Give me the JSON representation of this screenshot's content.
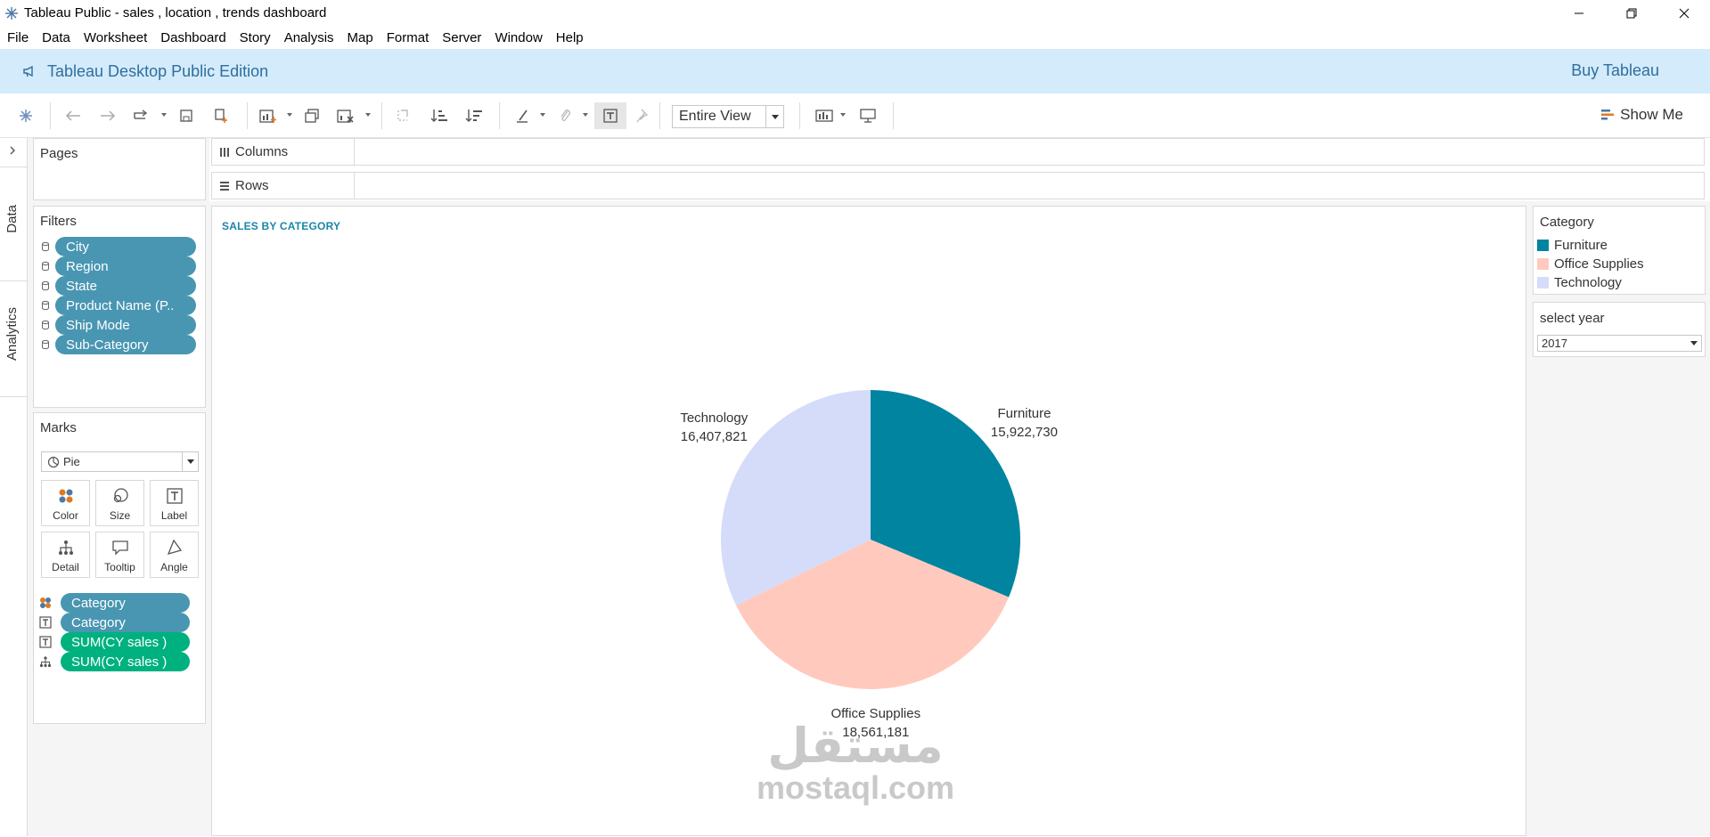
{
  "window": {
    "title": "Tableau Public - sales , location , trends dashboard",
    "buttons": [
      "minimize",
      "restore",
      "close"
    ]
  },
  "menu": [
    "File",
    "Data",
    "Worksheet",
    "Dashboard",
    "Story",
    "Analysis",
    "Map",
    "Format",
    "Server",
    "Window",
    "Help"
  ],
  "banner": {
    "edition": "Tableau Desktop Public Edition",
    "buy": "Buy Tableau"
  },
  "toolbar": {
    "fit": "Entire View",
    "show_me": "Show Me"
  },
  "side_tabs": {
    "data": "Data",
    "analytics": "Analytics"
  },
  "pages": {
    "title": "Pages"
  },
  "filters": {
    "title": "Filters",
    "items": [
      "City",
      "Region",
      "State",
      "Product Name (P..",
      "Ship Mode",
      "Sub-Category"
    ]
  },
  "marks": {
    "title": "Marks",
    "type": "Pie",
    "buttons": [
      "Color",
      "Size",
      "Label",
      "Detail",
      "Tooltip",
      "Angle"
    ],
    "fields": [
      {
        "label": "Category",
        "kind": "color"
      },
      {
        "label": "Category",
        "kind": "label"
      },
      {
        "label": "SUM(CY sales )",
        "kind": "label"
      },
      {
        "label": "SUM(CY sales )",
        "kind": "detail"
      }
    ]
  },
  "shelves": {
    "columns": "Columns",
    "rows": "Rows"
  },
  "view": {
    "title": "SALES BY CATEGORY"
  },
  "chart_data": {
    "type": "pie",
    "title": "SALES BY CATEGORY",
    "categories": [
      "Furniture",
      "Office Supplies",
      "Technology"
    ],
    "values": [
      15922730,
      18561181,
      16407821
    ],
    "value_labels": [
      "15,922,730",
      "18,561,181",
      "16,407,821"
    ],
    "colors": [
      "#00849f",
      "#ffcabd",
      "#d4dcfa"
    ],
    "legend": "right"
  },
  "legend": {
    "title": "Category",
    "items": [
      {
        "label": "Furniture",
        "color": "#00849f"
      },
      {
        "label": "Office Supplies",
        "color": "#ffcabd"
      },
      {
        "label": "Technology",
        "color": "#d4dcfa"
      }
    ]
  },
  "year_filter": {
    "title": "select year",
    "value": "2017"
  },
  "watermark": {
    "arabic": "مستقل",
    "latin": "mostaql.com"
  }
}
